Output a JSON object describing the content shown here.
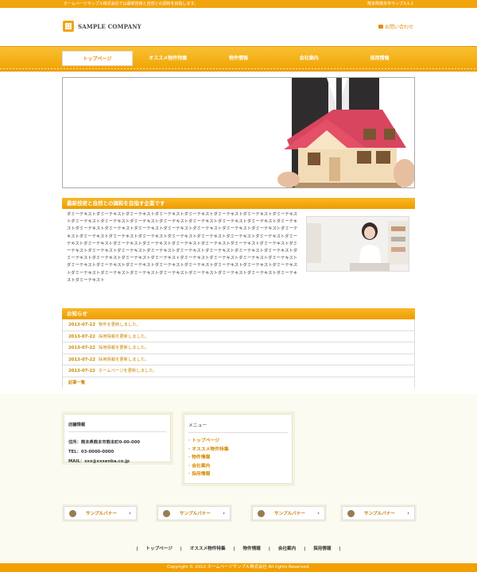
{
  "topbar": {
    "left_text": "ホームページサンプル株式会社では最新技術と自然との調和を目指します。",
    "right_text": "熊本県熊本市サンプル1-2"
  },
  "header": {
    "company_name": "SAMPLE COMPANY",
    "contact_label": "お問い合わせ"
  },
  "nav": {
    "items": [
      {
        "label": "トップページ"
      },
      {
        "label": "オススメ物件特集"
      },
      {
        "label": "物件情報"
      },
      {
        "label": "会社案内"
      },
      {
        "label": "採用情報"
      }
    ]
  },
  "about": {
    "title": "最新技術と自然との調和を目指す企業です",
    "body": "ダミーテキストダミーテキストダミーテキストダミーテキストダミーテキストダミーテキストダミーテキストダミーテキストダミーテキストダミーテキストダミーテキストダミーテキストダミーテキストダミーテキストダミーテキストダミーテキストダミーテキストダミーテキストダミーテキストダミーテキストダミーテキストダミーテキストダミーテキストダミーテキストダミーテキストダミーテキストダミーテキストダミーテキストダミーテキストダミーテキストダミーテキストダミーテキストダミーテキストダミーテキストダミーテキストダミーテキストダミーテキストダミーテキストダミーテキストダミーテキストダミーテキストダミーテキストダミーテキストダミーテキストダミーテキストダミーテキストダミーテキストダミーテキストダミーテキストダミーテキストダミーテキストダミーテキストダミーテキストダミーテキストダミーテキストダミーテキストダミーテキストダミーテキストダミーテキストダミーテキストダミーテキストダミーテキストダミーテキストダミーテキストダミーテキストダミーテキストダミーテキストダミーテキストダミーテキストダミーテキストダミーテキストダミーテキスト"
  },
  "news": {
    "title": "お知らせ",
    "items": [
      {
        "date": "2013-07-22",
        "text": "物件を更新しました。"
      },
      {
        "date": "2013-07-22",
        "text": "採用情報を更新しました。"
      },
      {
        "date": "2013-07-22",
        "text": "採用情報を更新しました。"
      },
      {
        "date": "2013-07-22",
        "text": "採用情報を更新しました。"
      },
      {
        "date": "2013-07-22",
        "text": "ホームページを更新しました。"
      }
    ],
    "more_label": "記事一覧"
  },
  "store": {
    "title": "店舗情報",
    "address": "住所：熊本県熊本市熊本町0-00-000",
    "tel": "TEL：03-0000-0000",
    "mail": "MAIL：xxx@xxxenba.co.jp"
  },
  "menu": {
    "title": "メニュー",
    "items": [
      {
        "label": "トップページ"
      },
      {
        "label": "オススメ物件特集"
      },
      {
        "label": "物件情報"
      },
      {
        "label": "会社案内"
      },
      {
        "label": "採用情報"
      }
    ]
  },
  "banners": [
    {
      "label": "サンプルバナー"
    },
    {
      "label": "サンプルバナー"
    },
    {
      "label": "サンプルバナー"
    },
    {
      "label": "サンプルバナー"
    }
  ],
  "footer": {
    "nav": [
      "トップページ",
      "オススメ物件特集",
      "物件情報",
      "会社案内",
      "採用情報"
    ],
    "separator": "|",
    "copyright": "Copyright © 2012 ホームページサンプル株式会社 All rights Reserved."
  },
  "colors": {
    "accent": "#f2a40d",
    "link": "#d68b00",
    "footer_bg": "#fbfbf1"
  }
}
